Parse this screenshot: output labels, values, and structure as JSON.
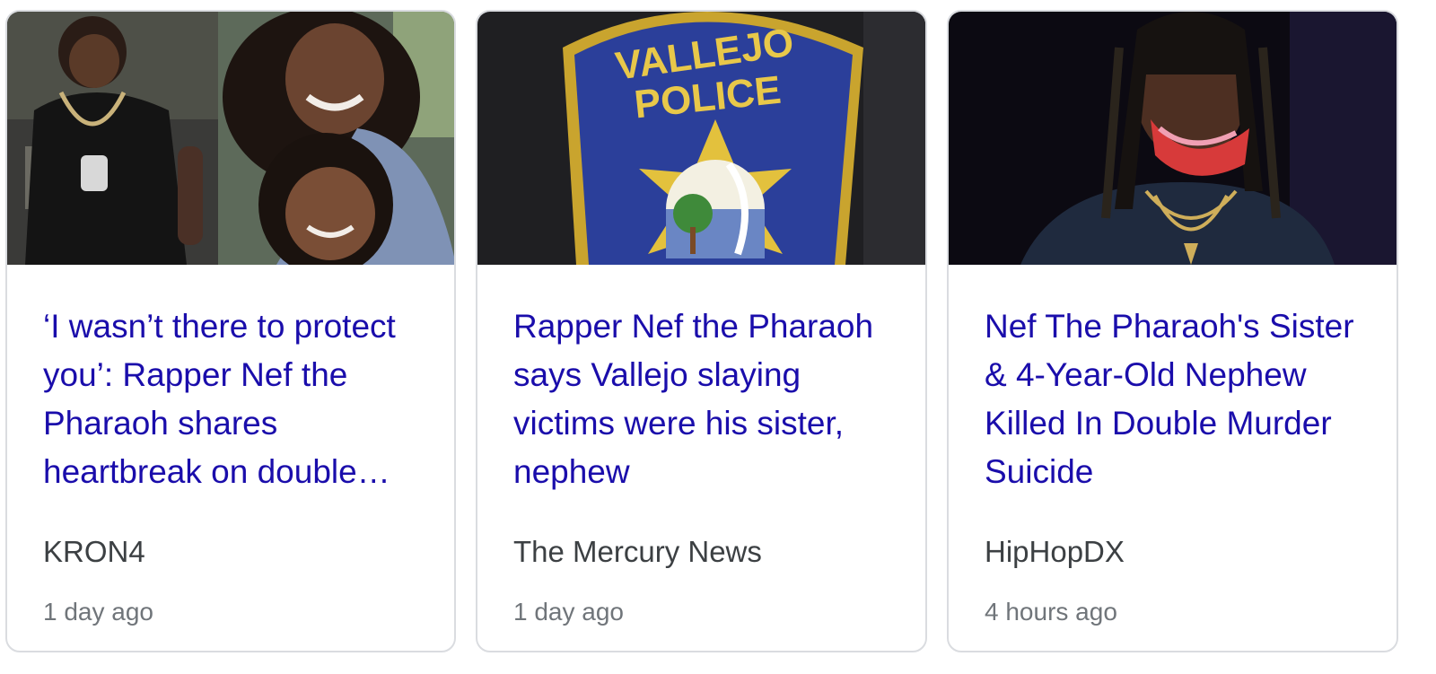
{
  "cards": [
    {
      "headline": "‘I wasn’t there to protect you’: Rapper Nef the Pharaoh shares heartbreak on double…",
      "source": "KRON4",
      "time": "1 day ago",
      "thumbnail": "photo-of-rapper-and-woman-with-child"
    },
    {
      "headline": "Rapper Nef the Pharaoh says Vallejo slaying victims were his sister, nephew",
      "source": "The Mercury News",
      "time": "1 day ago",
      "thumbnail": "vallejo-police-badge-patch",
      "badge_text": "VALLEJO POLICE"
    },
    {
      "headline": "Nef The Pharaoh's Sister & 4-Year-Old Nephew Killed In Double Murder Suicide",
      "source": "HipHopDX",
      "time": "4 hours ago",
      "thumbnail": "photo-of-rapper-with-face-mask"
    }
  ],
  "colors": {
    "headline": "#1a0dab",
    "source": "#3c4043",
    "time": "#70757a",
    "card_border": "#dadce0"
  }
}
